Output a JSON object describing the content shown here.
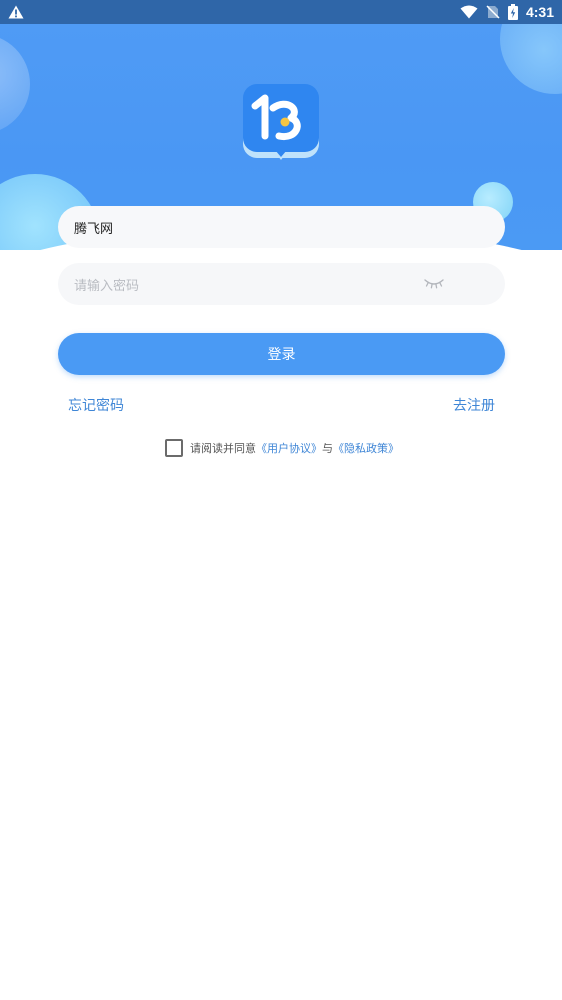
{
  "status_bar": {
    "time": "4:31",
    "icons": [
      "warning-icon",
      "wifi-icon",
      "no-sim-icon",
      "battery-icon"
    ]
  },
  "colors": {
    "status_bar": "#2f66a8",
    "primary": "#4a9af4",
    "link": "#3f86d6"
  },
  "login_form": {
    "username_value": "腾飞网",
    "password_placeholder": "请输入密码",
    "password_toggle_icon": "eye-closed-icon",
    "login_label": "登录"
  },
  "links": {
    "forgot_password": "忘记密码",
    "register": "去注册"
  },
  "agreement": {
    "checked": false,
    "prefix": "请阅读并同意",
    "user_agreement": "《用户协议》",
    "conjunction": "与",
    "privacy_policy": "《隐私政策》"
  }
}
